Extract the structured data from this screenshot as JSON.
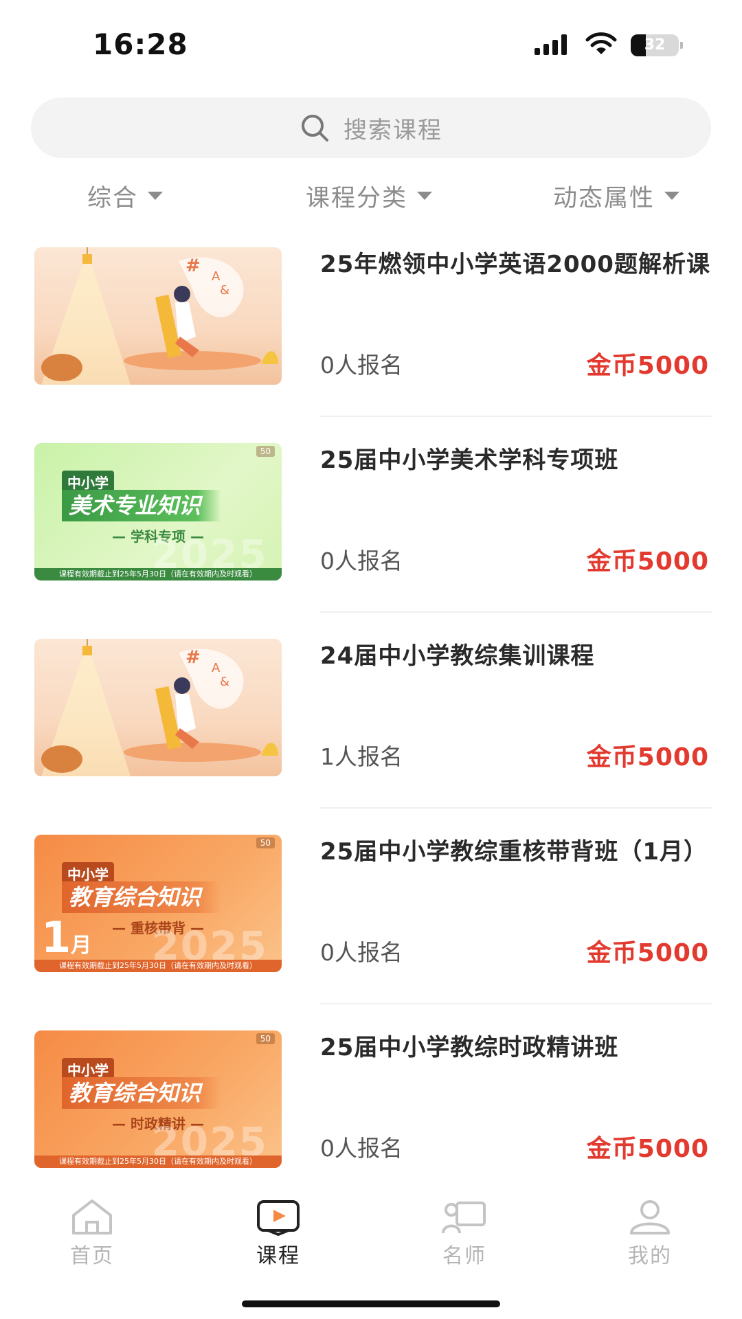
{
  "status": {
    "time": "16:28",
    "battery": "32",
    "battery_level": 0.32
  },
  "search": {
    "placeholder": "搜索课程",
    "icon": "search-icon"
  },
  "filters": [
    {
      "label": "综合"
    },
    {
      "label": "课程分类"
    },
    {
      "label": "动态属性"
    }
  ],
  "courses": [
    {
      "title": "25年燃领中小学英语2000题解析课",
      "enroll": "0人报名",
      "price": "金币5000",
      "thumb": {
        "style": "lamp"
      }
    },
    {
      "title": "25届中小学美术学科专项班",
      "enroll": "0人报名",
      "price": "金币5000",
      "thumb": {
        "style": "green",
        "badge": "中小学",
        "title": "美术专业知识",
        "sub": "— 学科专项 —",
        "year": "2025",
        "foot": "课程有效期截止到25年5月30日（请在有效期内及时观看）",
        "logo": "50"
      }
    },
    {
      "title": "24届中小学教综集训课程",
      "enroll": "1人报名",
      "price": "金币5000",
      "thumb": {
        "style": "lamp"
      }
    },
    {
      "title": "25届中小学教综重核带背班（1月）",
      "enroll": "0人报名",
      "price": "金币5000",
      "thumb": {
        "style": "orange",
        "badge": "中小学",
        "title": "教育综合知识",
        "sub": "— 重核带背 —",
        "year": "2025",
        "month": "1",
        "month_unit": "月",
        "foot": "课程有效期截止到25年5月30日（请在有效期内及时观看）",
        "logo": "50"
      }
    },
    {
      "title": "25届中小学教综时政精讲班",
      "enroll": "0人报名",
      "price": "金币5000",
      "thumb": {
        "style": "orange",
        "badge": "中小学",
        "title": "教育综合知识",
        "sub": "— 时政精讲 —",
        "year": "2025",
        "foot": "课程有效期截止到25年5月30日（请在有效期内及时观看）",
        "logo": "50"
      }
    }
  ],
  "tabbar": [
    {
      "label": "首页",
      "icon": "home-icon",
      "active": false
    },
    {
      "label": "课程",
      "icon": "course-play-icon",
      "active": true
    },
    {
      "label": "名师",
      "icon": "teacher-icon",
      "active": false
    },
    {
      "label": "我的",
      "icon": "profile-icon",
      "active": false
    }
  ],
  "colors": {
    "price": "#e33a2f",
    "accent": "#f58b45",
    "muted": "#8c8c8c"
  }
}
